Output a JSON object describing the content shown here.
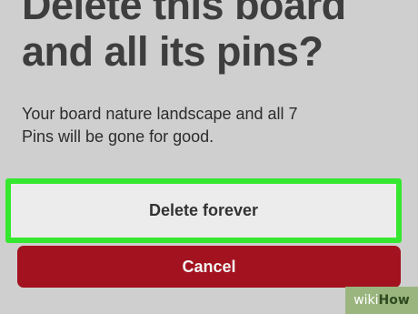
{
  "dialog": {
    "title_line1": "Delete this board",
    "title_line2": "and all its pins?",
    "message_line1": "Your board nature landscape and all 7",
    "message_line2": "Pins will be gone for good."
  },
  "buttons": {
    "delete_label": "Delete forever",
    "cancel_label": "Cancel"
  },
  "watermark": {
    "part1": "wiki",
    "part2": "How"
  },
  "colors": {
    "background": "#cfcfcf",
    "highlight_border": "#35e82f",
    "cancel_button": "#a3121f",
    "delete_button": "#ececec"
  }
}
